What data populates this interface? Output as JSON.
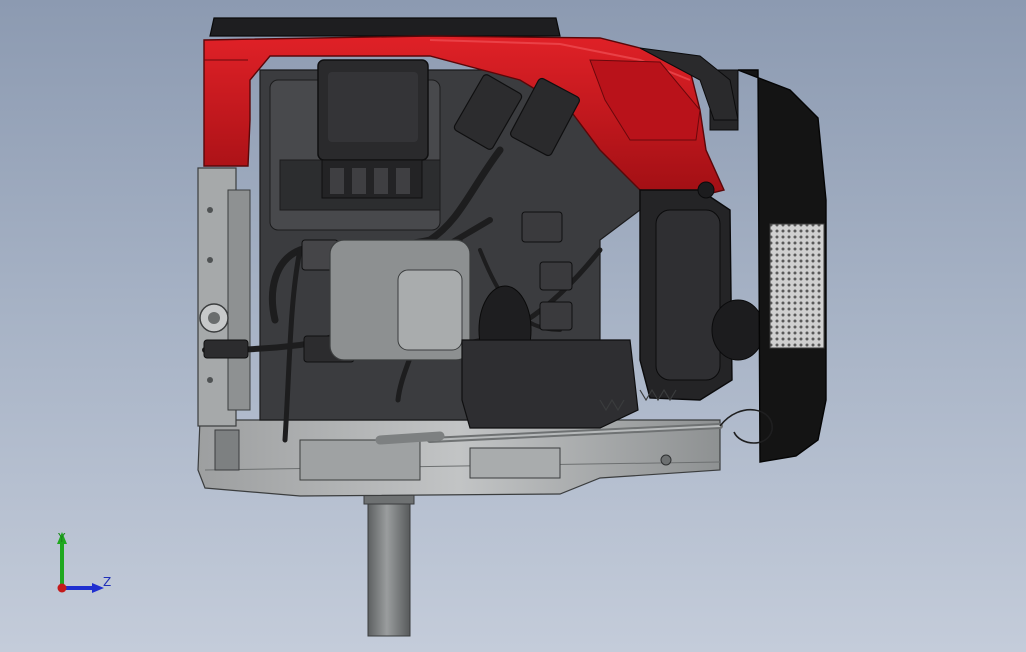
{
  "viewport": {
    "background_top": "#8c9ab1",
    "background_bottom": "#c4ccda",
    "model": "engine-assembly-side-view"
  },
  "colors": {
    "shroud_red": "#d0161c",
    "shroud_red_dark": "#8e0d11",
    "body_dark": "#2e2e30",
    "body_mid": "#4a4a4d",
    "metal_light": "#b9bbbc",
    "metal_mid": "#8d9091",
    "shaft": "#7a7d7e",
    "muffler_black": "#121212",
    "screen_grey": "#c9c9c9"
  },
  "triad": {
    "y_label": "Y",
    "z_label": "Z",
    "y_color": "#1fa81f",
    "z_color": "#1f2fd0",
    "x_color": "#c41a1a"
  }
}
